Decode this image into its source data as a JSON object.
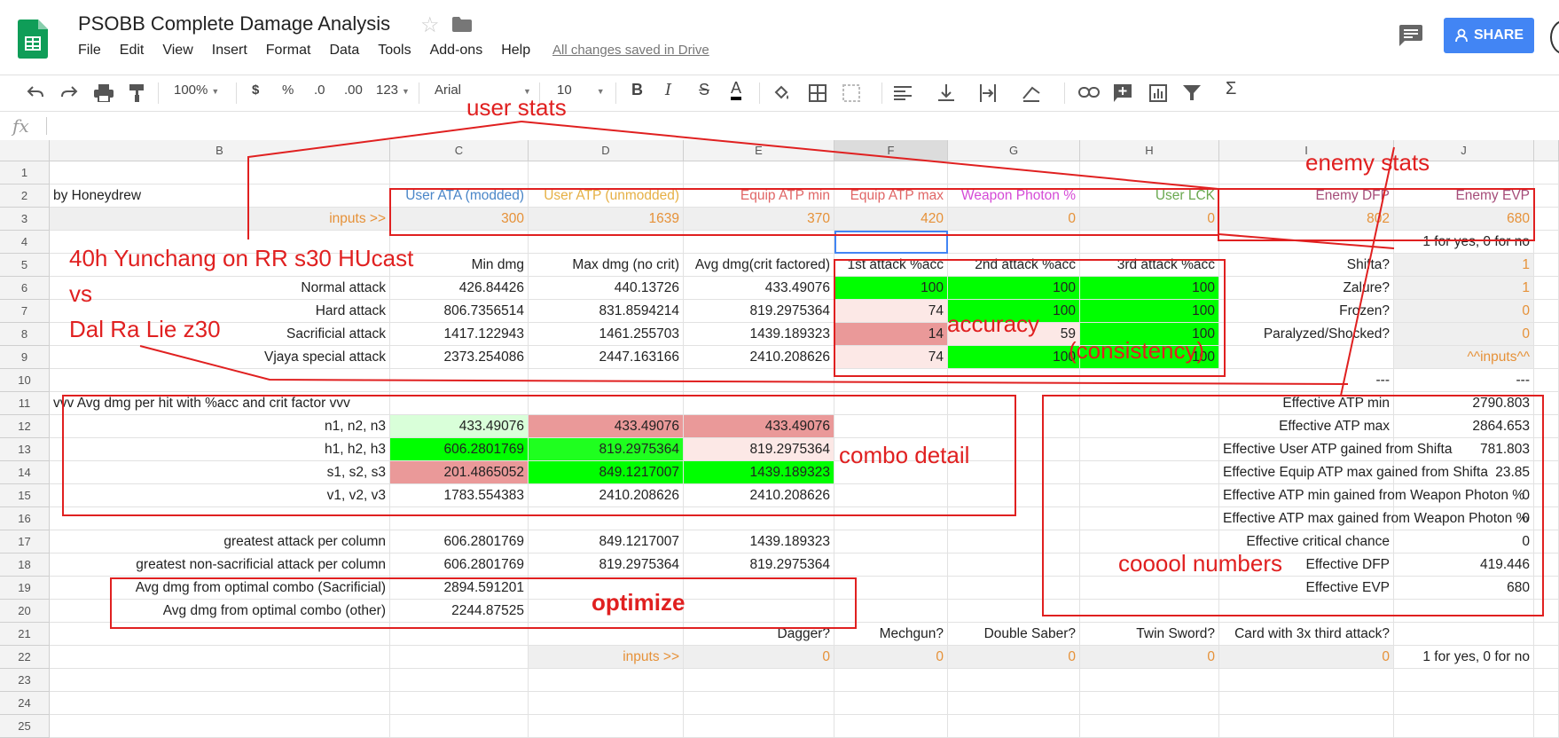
{
  "app": {
    "title": "PSOBB Complete Damage Analysis",
    "menu": [
      "File",
      "Edit",
      "View",
      "Insert",
      "Format",
      "Data",
      "Tools",
      "Add-ons",
      "Help"
    ],
    "save_status": "All changes saved in Drive",
    "share_label": "SHARE"
  },
  "toolbar": {
    "zoom": "100%",
    "currency": "$",
    "percent": "%",
    "dec_decrease": ".0",
    "dec_increase": ".00",
    "more_formats": "123",
    "font": "Arial",
    "font_size": "10",
    "bold": "B",
    "italic": "I",
    "strike": "S",
    "textcolor": "A",
    "functions": "Σ"
  },
  "formula_bar": {
    "fx": "fx",
    "value": ""
  },
  "columns": [
    "B",
    "C",
    "D",
    "E",
    "F",
    "G",
    "H",
    "I",
    "J"
  ],
  "rows": [
    "1",
    "2",
    "3",
    "4",
    "5",
    "6",
    "7",
    "8",
    "9",
    "10",
    "11",
    "12",
    "13",
    "14",
    "15",
    "16",
    "17",
    "18",
    "19",
    "20",
    "21",
    "22",
    "23",
    "24",
    "25"
  ],
  "sheet": {
    "r2": {
      "b": "by Honeydrew",
      "c": "User ATA (modded)",
      "d": "User ATP (unmodded)",
      "e": "Equip ATP min",
      "f": "Equip ATP max",
      "g": "Weapon Photon %",
      "h": "User LCK",
      "i": "Enemy DFP",
      "j": "Enemy EVP"
    },
    "r3": {
      "b": "inputs >>",
      "c": "300",
      "d": "1639",
      "e": "370",
      "f": "420",
      "g": "0",
      "h": "0",
      "i": "802",
      "j": "680"
    },
    "r4": {
      "j": "1 for yes, 0 for no"
    },
    "r5": {
      "c": "Min dmg",
      "d": "Max dmg (no crit)",
      "e": "Avg dmg(crit factored)",
      "f": "1st attack %acc",
      "g": "2nd attack %acc",
      "h": "3rd attack %acc",
      "i": "Shifta?",
      "j": "1"
    },
    "r6": {
      "b": "Normal attack",
      "c": "426.84426",
      "d": "440.13726",
      "e": "433.49076",
      "f": "100",
      "g": "100",
      "h": "100",
      "i": "Zalure?",
      "j": "1"
    },
    "r7": {
      "b": "Hard attack",
      "c": "806.7356514",
      "d": "831.8594214",
      "e": "819.2975364",
      "f": "74",
      "g": "100",
      "h": "100",
      "i": "Frozen?",
      "j": "0"
    },
    "r8": {
      "b": "Sacrificial attack",
      "c": "1417.122943",
      "d": "1461.255703",
      "e": "1439.189323",
      "f": "14",
      "g": "59",
      "h": "100",
      "i": "Paralyzed/Shocked?",
      "j": "0"
    },
    "r9": {
      "b": "Vjaya special attack",
      "c": "2373.254086",
      "d": "2447.163166",
      "e": "2410.208626",
      "f": "74",
      "g": "100",
      "h": "100",
      "j": "^^inputs^^"
    },
    "r10": {
      "i": "---",
      "j": "---"
    },
    "r11": {
      "b": "vvv Avg dmg per hit with %acc and crit factor vvv",
      "i": "Effective ATP min",
      "j": "2790.803"
    },
    "r12": {
      "b": "n1, n2, n3",
      "c": "433.49076",
      "d": "433.49076",
      "e": "433.49076",
      "i": "Effective ATP max",
      "j": "2864.653"
    },
    "r13": {
      "b": "h1, h2, h3",
      "c": "606.2801769",
      "d": "819.2975364",
      "e": "819.2975364",
      "i": "Effective User ATP gained from Shifta",
      "j": "781.803"
    },
    "r14": {
      "b": "s1, s2, s3",
      "c": "201.4865052",
      "d": "849.1217007",
      "e": "1439.189323",
      "i": "Effective Equip ATP max gained from Shifta",
      "j": "23.85"
    },
    "r15": {
      "b": "v1, v2, v3",
      "c": "1783.554383",
      "d": "2410.208626",
      "e": "2410.208626",
      "i": "Effective ATP min gained from Weapon Photon %",
      "j": "0"
    },
    "r16": {
      "i": "Effective ATP max gained from Weapon Photon %",
      "j": "0"
    },
    "r17": {
      "b": "greatest attack per column",
      "c": "606.2801769",
      "d": "849.1217007",
      "e": "1439.189323",
      "i": "Effective critical chance",
      "j": "0"
    },
    "r18": {
      "b": "greatest non-sacrificial attack per column",
      "c": "606.2801769",
      "d": "819.2975364",
      "e": "819.2975364",
      "i": "Effective DFP",
      "j": "419.446"
    },
    "r19": {
      "b": "Avg dmg from optimal combo (Sacrificial)",
      "c": "2894.591201",
      "i": "Effective EVP",
      "j": "680"
    },
    "r20": {
      "b": "Avg dmg from optimal combo (other)",
      "c": "2244.87525"
    },
    "r21": {
      "e": "Dagger?",
      "f": "Mechgun?",
      "g": "Double Saber?",
      "h": "Twin Sword?",
      "i": "Card with 3x third attack?"
    },
    "r22": {
      "d": "inputs >>",
      "e": "0",
      "f": "0",
      "g": "0",
      "h": "0",
      "i": "0",
      "j": "1 for yes, 0 for no"
    }
  },
  "annotations": {
    "user_stats": "user stats",
    "enemy_stats": "enemy stats",
    "matchup_line1": "40h Yunchang on RR s30 HUcast",
    "matchup_line2": "vs",
    "matchup_line3": "Dal Ra Lie z30",
    "accuracy": "accuracy",
    "consistency": "(consistency)",
    "combo_detail": "combo detail",
    "optimize": "optimize",
    "cool_numbers": "cooool numbers"
  },
  "colors": {
    "annotation": "#e02020",
    "share": "#4285f4",
    "sheets_green": "#0f9d58"
  }
}
